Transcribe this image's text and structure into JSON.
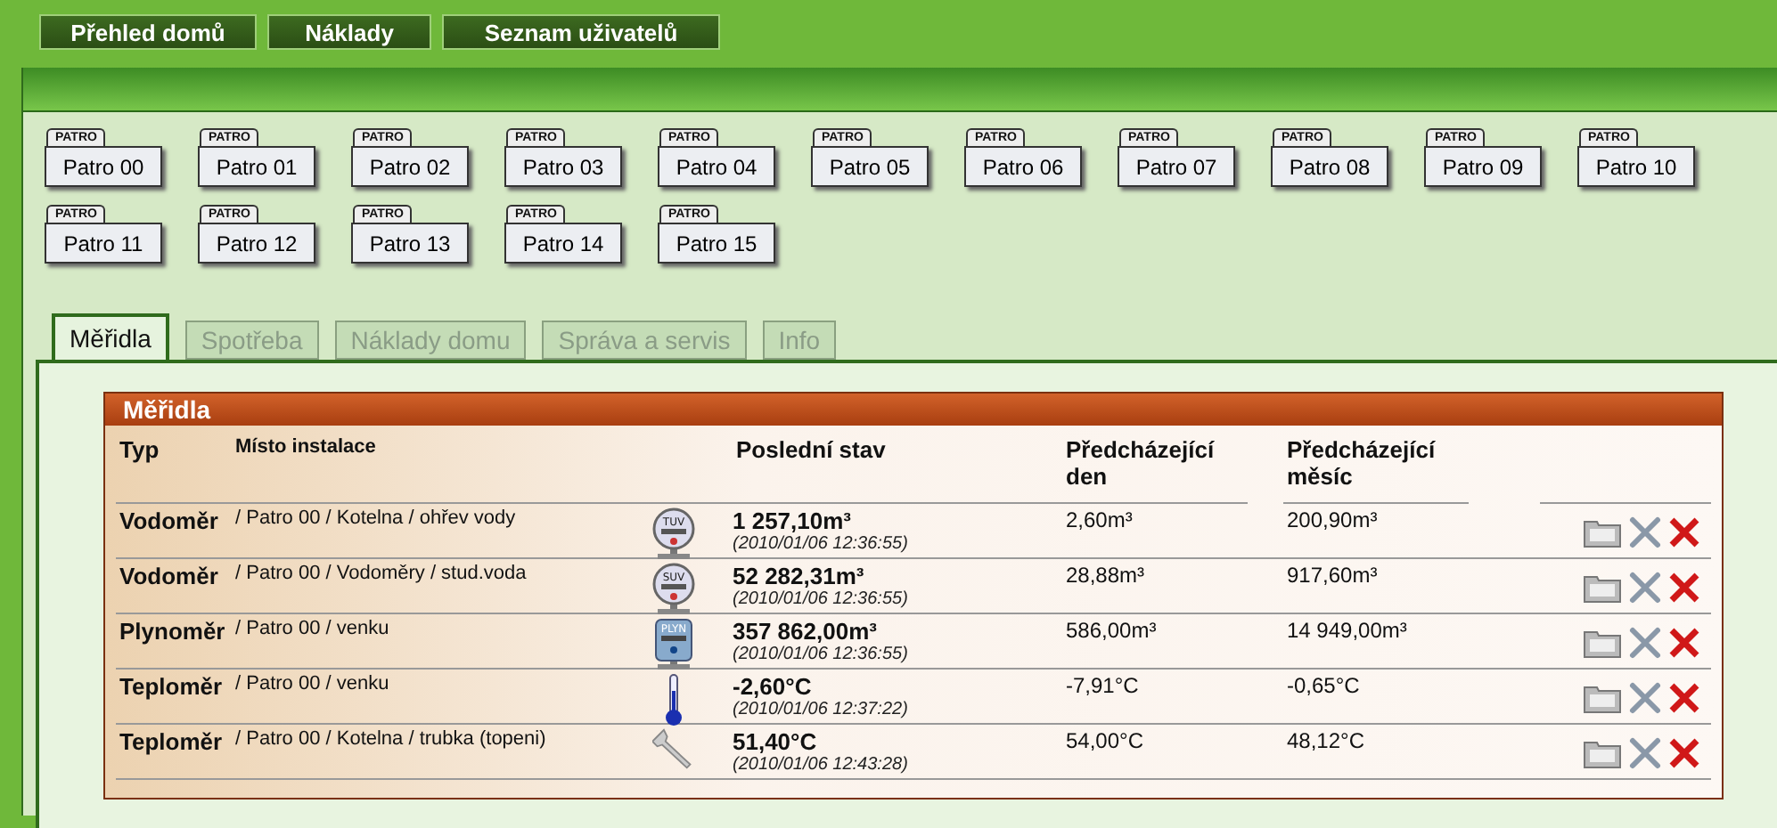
{
  "nav": [
    {
      "label": "Přehled domů"
    },
    {
      "label": "Náklady"
    },
    {
      "label": "Seznam uživatelů"
    }
  ],
  "floors": [
    {
      "tag": "PATRO",
      "label": "Patro 00"
    },
    {
      "tag": "PATRO",
      "label": "Patro 01"
    },
    {
      "tag": "PATRO",
      "label": "Patro 02"
    },
    {
      "tag": "PATRO",
      "label": "Patro 03"
    },
    {
      "tag": "PATRO",
      "label": "Patro 04"
    },
    {
      "tag": "PATRO",
      "label": "Patro 05"
    },
    {
      "tag": "PATRO",
      "label": "Patro 06"
    },
    {
      "tag": "PATRO",
      "label": "Patro 07"
    },
    {
      "tag": "PATRO",
      "label": "Patro 08"
    },
    {
      "tag": "PATRO",
      "label": "Patro 09"
    },
    {
      "tag": "PATRO",
      "label": "Patro 10"
    },
    {
      "tag": "PATRO",
      "label": "Patro 11"
    },
    {
      "tag": "PATRO",
      "label": "Patro 12"
    },
    {
      "tag": "PATRO",
      "label": "Patro 13"
    },
    {
      "tag": "PATRO",
      "label": "Patro 14"
    },
    {
      "tag": "PATRO",
      "label": "Patro 15"
    }
  ],
  "tabs": [
    {
      "label": "Měřidla",
      "selected": true
    },
    {
      "label": "Spotřeba",
      "selected": false
    },
    {
      "label": "Náklady domu",
      "selected": false
    },
    {
      "label": "Správa a servis",
      "selected": false
    },
    {
      "label": "Info",
      "selected": false
    }
  ],
  "panel": {
    "title": "Měřidla",
    "columns": [
      {
        "label": "Typ"
      },
      {
        "label": "Místo instalace"
      },
      {
        "label": "Poslední stav"
      },
      {
        "label": "Předcházející den"
      },
      {
        "label": "Předcházející měsíc"
      }
    ],
    "rows": [
      {
        "type": "Vodoměr",
        "location": "/ Patro 00 / Kotelna / ohřev vody",
        "icon": {
          "kind": "gauge",
          "label": "TUV"
        },
        "value": "1 257,10m³",
        "time": "(2010/01/06 12:36:55)",
        "day": "2,60m³",
        "month": "200,90m³"
      },
      {
        "type": "Vodoměr",
        "location": "/ Patro 00 / Vodoměry / stud.voda",
        "icon": {
          "kind": "gauge",
          "label": "SUV"
        },
        "value": "52 282,31m³",
        "time": "(2010/01/06 12:36:55)",
        "day": "28,88m³",
        "month": "917,60m³"
      },
      {
        "type": "Plynoměr",
        "location": "/ Patro 00 / venku",
        "icon": {
          "kind": "gasmeter",
          "label": "PLYN"
        },
        "value": "357 862,00m³",
        "time": "(2010/01/06 12:36:55)",
        "day": "586,00m³",
        "month": "14 949,00m³"
      },
      {
        "type": "Teploměr",
        "location": "/ Patro 00 / venku",
        "icon": {
          "kind": "thermometer"
        },
        "value": "-2,60°C",
        "time": "(2010/01/06 12:37:22)",
        "day": "-7,91°C",
        "month": "-0,65°C"
      },
      {
        "type": "Teploměr",
        "location": "/ Patro 00 / Kotelna / trubka (topeni)",
        "icon": {
          "kind": "wrench"
        },
        "value": "51,40°C",
        "time": "(2010/01/06 12:43:28)",
        "day": "54,00°C",
        "month": "48,12°C"
      }
    ]
  }
}
